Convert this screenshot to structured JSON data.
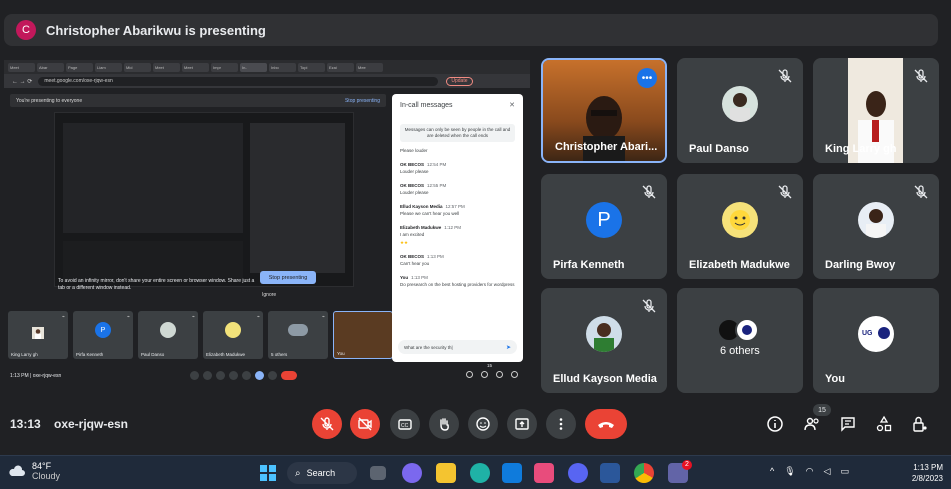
{
  "banner": {
    "avatar_letter": "C",
    "text": "Christopher Abarikwu is presenting"
  },
  "shared_screen": {
    "tabs": [
      "Meet",
      "Abar",
      "Page",
      "Liam",
      "Mid",
      "Meet",
      "Meet",
      "Impr",
      "In-",
      "Inbo",
      "Topi",
      "Ezai",
      "Mee"
    ],
    "url": "meet.google.com/oxe-rjqw-esn",
    "update_label": "Update",
    "presenting_text": "You're presenting to everyone",
    "stop_presenting_link": "Stop presenting",
    "warning_text": "To avoid an infinity mirror, don't share your entire screen or browser window. Share just a tab or a different window instead.",
    "stop_presenting_button": "Stop presenting",
    "ignore_label": "Ignore",
    "tiles": [
      {
        "label": "King Larry gh"
      },
      {
        "label": "Pirfa Kenneth",
        "letter": "P"
      },
      {
        "label": "Paul Danso"
      },
      {
        "label": "Elizabeth Madukwe"
      },
      {
        "label": "5 others"
      },
      {
        "label": "You"
      }
    ],
    "time_code": "1:13 PM  |  oxe-rjqw-esn",
    "participant_badge": "15"
  },
  "chat": {
    "title": "In-call messages",
    "notice": "Messages can only be seen by people in the call and are deleted when the call ends",
    "messages": [
      {
        "who": "",
        "time": "",
        "body": "Please louder"
      },
      {
        "who": "OK BECOS",
        "time": "12:54 PM",
        "body": "Louder please"
      },
      {
        "who": "OK BECOS",
        "time": "12:55 PM",
        "body": "Louder please"
      },
      {
        "who": "Ellud Kayson Media",
        "time": "12:57 PM",
        "body": "Please we can't hear you well"
      },
      {
        "who": "Elizabeth Madukwe",
        "time": "1:12 PM",
        "body": "I am excited"
      },
      {
        "who": "",
        "time": "",
        "body": "★★",
        "emoji": true
      },
      {
        "who": "OK BECOS",
        "time": "1:13 PM",
        "body": "Can't hear you"
      },
      {
        "who": "You",
        "time": "1:13 PM",
        "body": "Do presearch on the best hosting providers for wordpress"
      }
    ],
    "input_value": "What are the security th|"
  },
  "participants": [
    {
      "name": "Christopher Abari...",
      "active": true
    },
    {
      "name": "Paul Danso"
    },
    {
      "name": "King Larry gh"
    },
    {
      "name": "Pirfa Kenneth",
      "letter": "P"
    },
    {
      "name": "Elizabeth Madukwe"
    },
    {
      "name": "Darling Bwoy"
    },
    {
      "name": "Ellud Kayson Media"
    },
    {
      "name": "6 others",
      "logo_text": "Under Grace"
    },
    {
      "name": "You",
      "logo_text": "Under Grace"
    }
  ],
  "meetbar": {
    "time": "13:13",
    "code": "oxe-rjqw-esn",
    "participant_count": "15"
  },
  "taskbar": {
    "temperature": "84°F",
    "weather": "Cloudy",
    "search_label": "Search",
    "teams_badge": "2",
    "time": "1:13 PM",
    "date": "2/8/2023"
  },
  "colors": {
    "accent": "#8ab4f8",
    "danger": "#ea4335",
    "surface": "#3c4043",
    "background": "#202124"
  }
}
